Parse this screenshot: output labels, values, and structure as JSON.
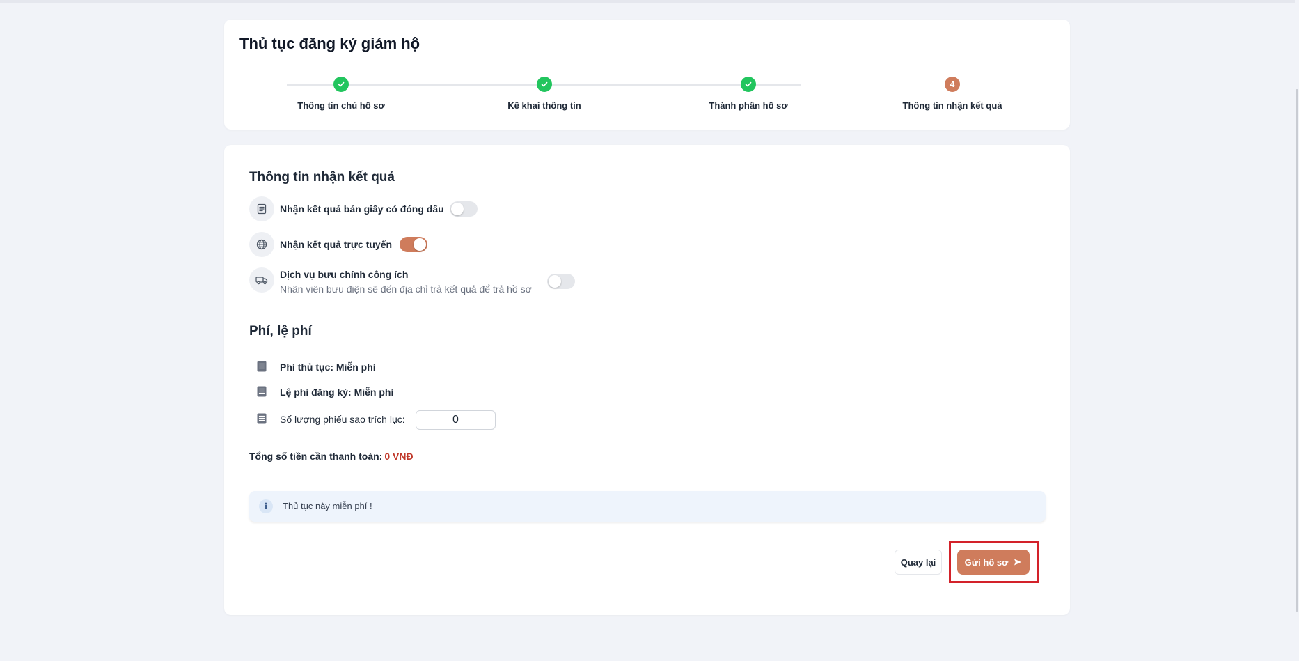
{
  "page": {
    "title": "Thủ tục đăng ký giám hộ"
  },
  "steps": [
    {
      "label": "Thông tin chủ hồ sơ",
      "status": "done",
      "marker": ""
    },
    {
      "label": "Kê khai thông tin",
      "status": "done",
      "marker": ""
    },
    {
      "label": "Thành phần hồ sơ",
      "status": "done",
      "marker": ""
    },
    {
      "label": "Thông tin nhận kết quả",
      "status": "current",
      "marker": "4"
    }
  ],
  "receive": {
    "title": "Thông tin nhận kết quả",
    "options": [
      {
        "label": "Nhận kết quả bản giấy có đóng dấu",
        "enabled": false,
        "icon": "document-icon"
      },
      {
        "label": "Nhận kết quả trực tuyến",
        "enabled": true,
        "icon": "globe-icon"
      },
      {
        "label": "Dịch vụ bưu chính công ích",
        "sublabel": "Nhân viên bưu điện sẽ đến địa chỉ trả kết quả để trả hồ sơ",
        "enabled": false,
        "icon": "delivery-truck-icon"
      }
    ]
  },
  "fees": {
    "title": "Phí, lệ phí",
    "procedure_fee": "Phí thủ tục: Miễn phí",
    "registration_fee": "Lệ phí đăng ký: Miễn phí",
    "copies_label": "Số lượng phiếu sao trích lục:",
    "copies_value": "0",
    "total_label": "Tổng số tiền cần thanh toán:",
    "total_value": "0 VNĐ"
  },
  "notice": {
    "text": "Thủ tục này miễn phí !",
    "icon": "i"
  },
  "actions": {
    "back_label": "Quay lại",
    "submit_label": "Gửi hồ sơ"
  },
  "colors": {
    "accent": "#cf7c5c",
    "success": "#22c55e",
    "total_amount": "#c0392b",
    "highlight": "#d3222a"
  }
}
